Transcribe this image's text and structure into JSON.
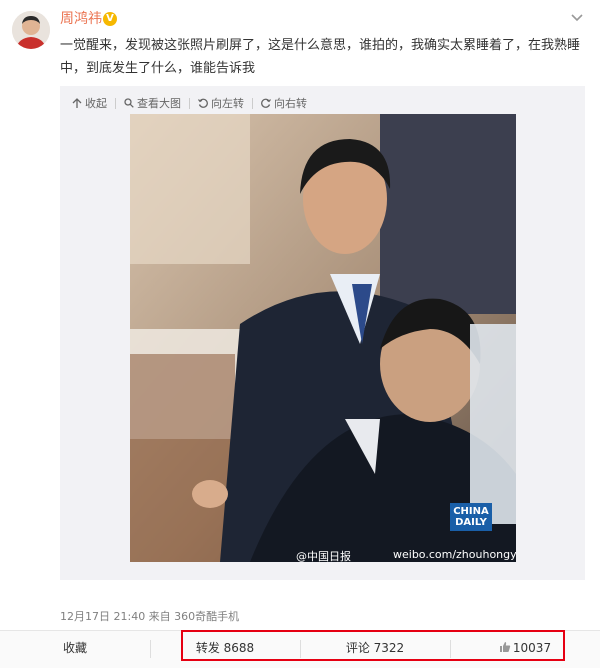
{
  "post": {
    "username": "周鸿祎",
    "verified_badge": "V",
    "text": "一觉醒来，发现被这张照片刷屏了，这是什么意思，谁拍的，我确实太累睡着了，在我熟睡中，到底发生了什么，谁能告诉我",
    "media_toolbar": {
      "collapse": "收起",
      "view_large": "查看大图",
      "rotate_left": "向左转",
      "rotate_right": "向右转"
    },
    "image": {
      "watermark_left": "@中国日报",
      "watermark_right": "weibo.com/zhouhongyi",
      "badge_line1": "CHINA",
      "badge_line2": "DAILY"
    },
    "meta": "12月17日 21:40 来自 360奇酷手机"
  },
  "actions": {
    "favorite": "收藏",
    "repost": "转发 8688",
    "comment": "评论 7322",
    "like": "10037"
  },
  "colors": {
    "username": "#eb7350",
    "highlight": "#e60012",
    "badge": "#f6b800"
  }
}
